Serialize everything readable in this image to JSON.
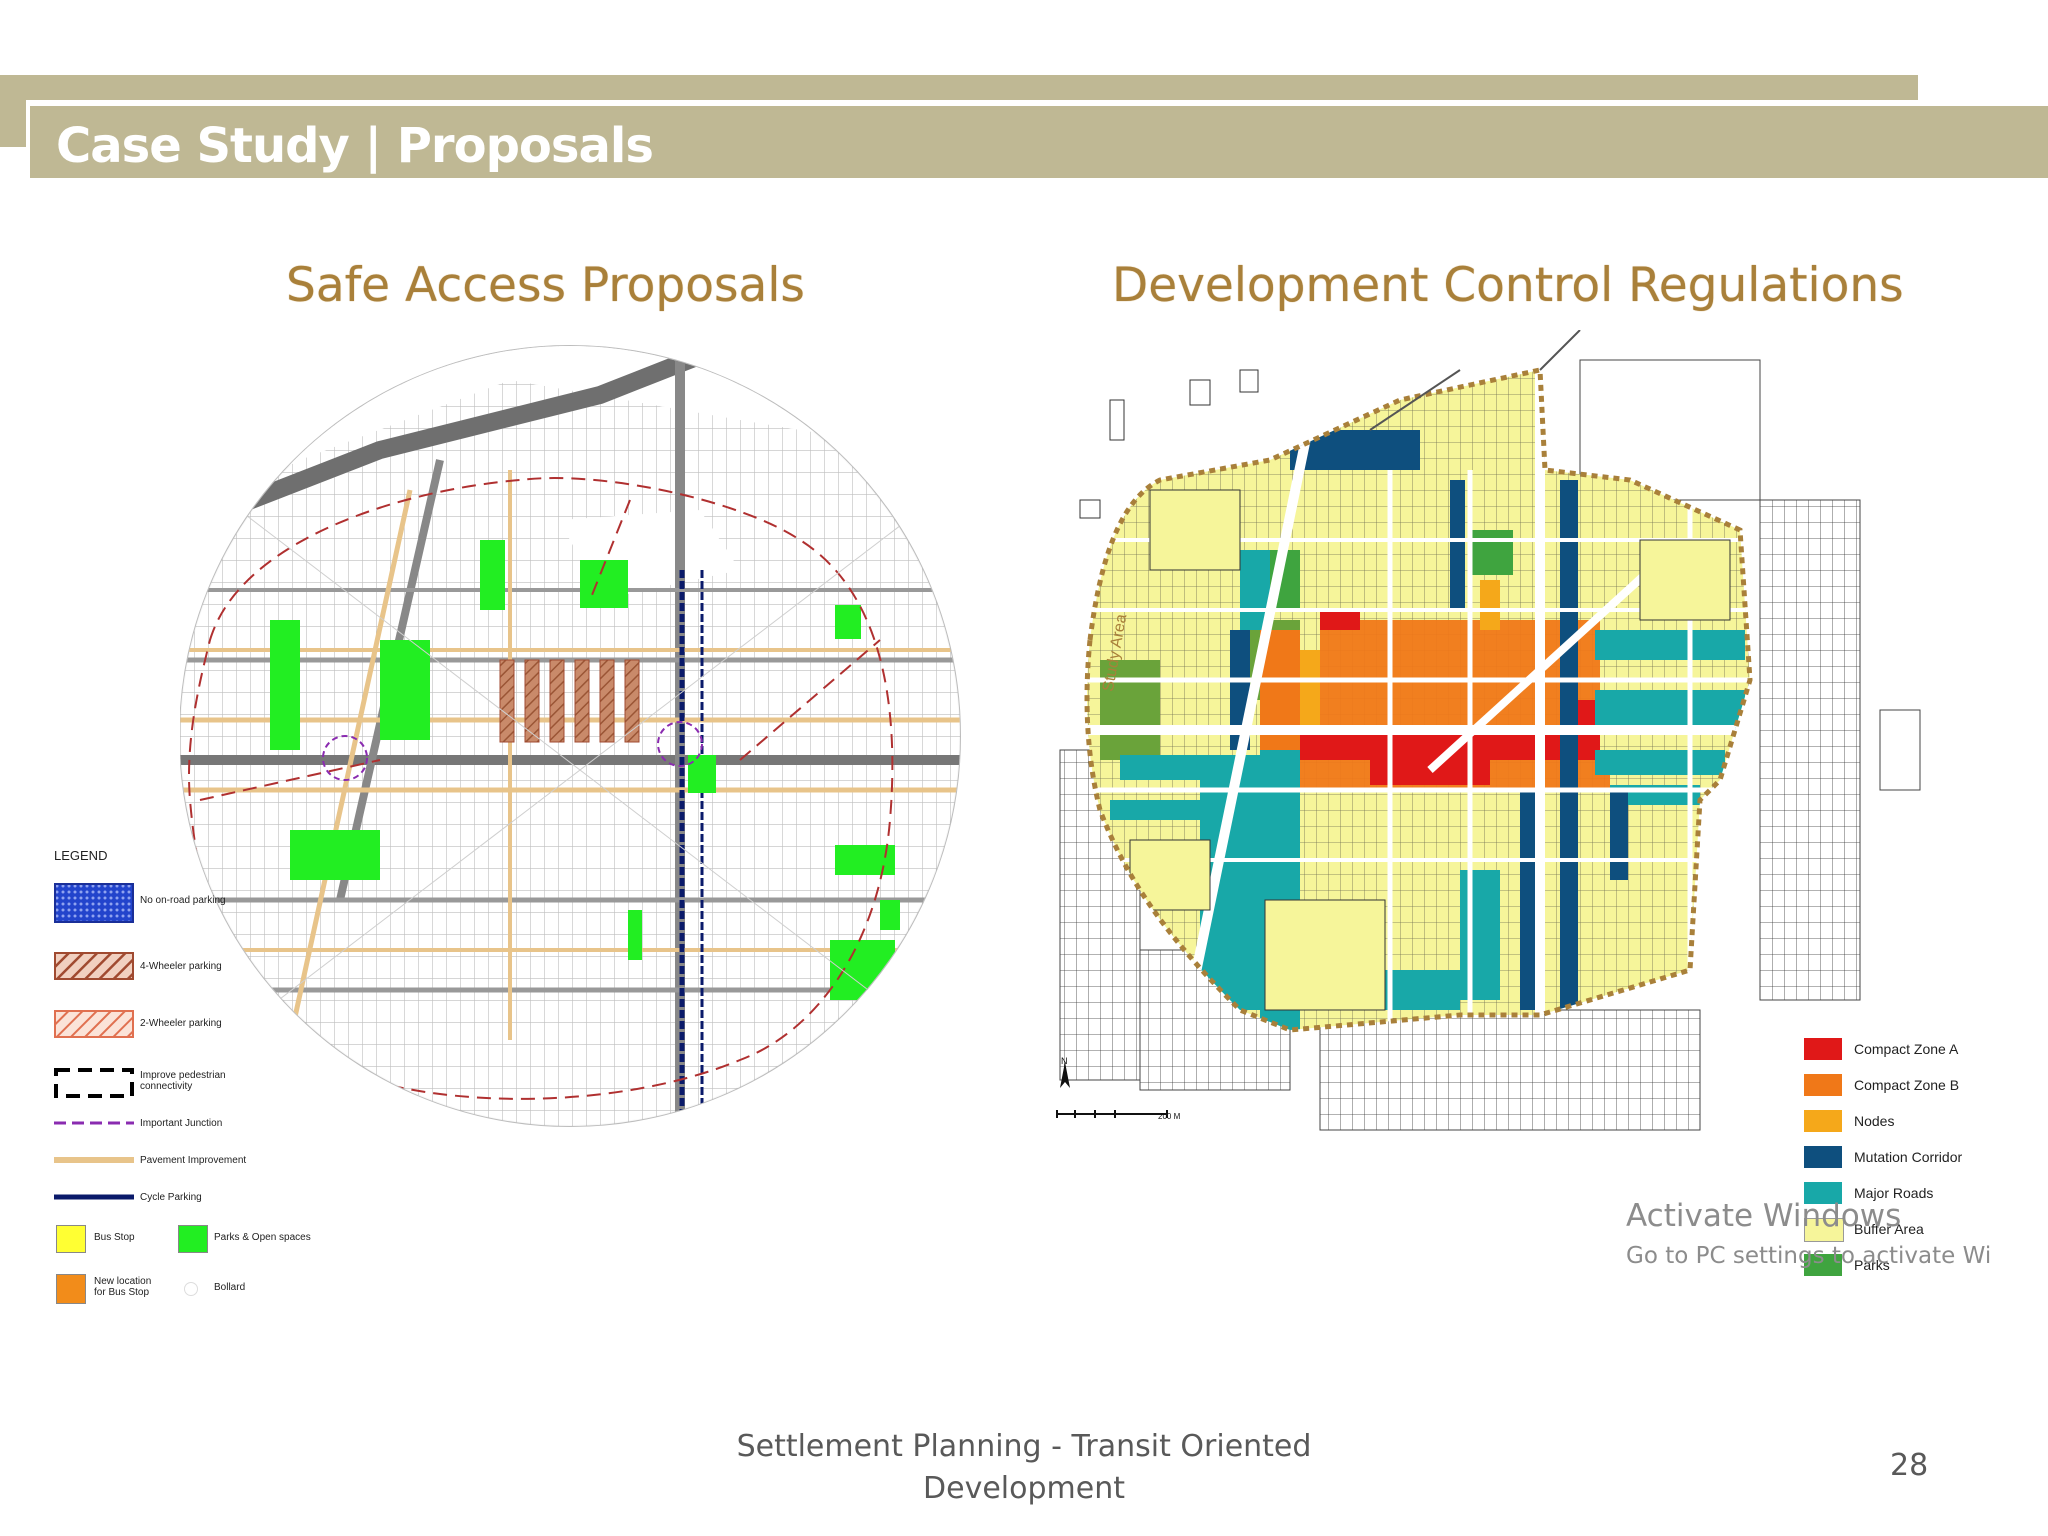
{
  "slide": {
    "title": "Case Study | Proposals",
    "footer": "Settlement Planning - Transit Oriented Development",
    "page_number": "28",
    "colors": {
      "band": "#bfb894",
      "heading": "#a9803a",
      "footer": "#595959"
    }
  },
  "left_map": {
    "heading": "Safe Access Proposals",
    "legend_title": "LEGEND",
    "legend": [
      {
        "label": "No on-road parking",
        "swatch": "#2244cc"
      },
      {
        "label": "4-Wheeler parking",
        "swatch": "#a04a30"
      },
      {
        "label": "2-Wheeler parking",
        "swatch": "#e07050"
      },
      {
        "label": "Improve pedestrian connectivity",
        "swatch": "#000000"
      },
      {
        "label": "Important Junction",
        "swatch": "#8a2bb0"
      },
      {
        "label": "Pavement Improvement",
        "swatch": "#e8c48a"
      },
      {
        "label": "Cycle Parking",
        "swatch": "#0a1a6a"
      },
      {
        "label": "Bus Stop",
        "swatch": "#ffff33"
      },
      {
        "label": "Parks & Open spaces",
        "swatch": "#22ee22"
      },
      {
        "label": "New location for Bus Stop",
        "swatch": "#f28c1a"
      },
      {
        "label": "Bollard",
        "swatch": "#ffffff"
      }
    ]
  },
  "right_map": {
    "heading": "Development Control Regulations",
    "legend": [
      {
        "label": "Compact Zone A",
        "color": "#e01818"
      },
      {
        "label": "Compact Zone B",
        "color": "#f07818"
      },
      {
        "label": "Nodes",
        "color": "#f5a81a"
      },
      {
        "label": "Mutation Corridor",
        "color": "#0e4f7e"
      },
      {
        "label": "Major Roads",
        "color": "#18a8a8"
      },
      {
        "label": "Buffer Area",
        "color": "#f6f59a"
      },
      {
        "label": "Parks",
        "color": "#3fa43f"
      }
    ],
    "scale_label": "200 M",
    "north_label": "N",
    "study_area_label": "Study Area"
  },
  "watermark": {
    "line1": "Activate Windows",
    "line2": "Go to PC settings to activate Wi"
  }
}
